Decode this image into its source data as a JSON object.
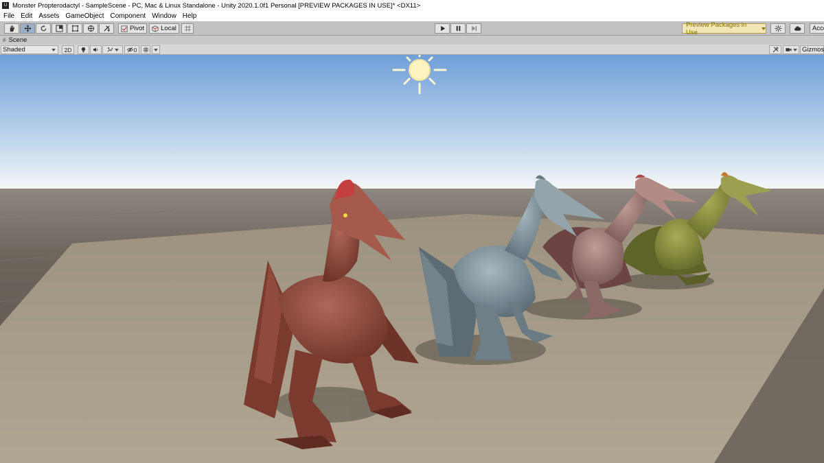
{
  "window": {
    "title": "Monster Propterodactyl - SampleScene - PC, Mac & Linux Standalone - Unity 2020.1.0f1 Personal [PREVIEW PACKAGES IN USE]* <DX11>",
    "app_icon_glyph": "U"
  },
  "menu": [
    "File",
    "Edit",
    "Assets",
    "GameObject",
    "Component",
    "Window",
    "Help"
  ],
  "toolbar": {
    "pivot_label": "Pivot",
    "local_label": "Local",
    "preview_label": "Preview Packages in Use",
    "account_label": "Acco",
    "icons": [
      "hand-icon",
      "move-icon",
      "rotate-icon",
      "scale-icon",
      "rect-icon",
      "transform-icon",
      "custom-tool-icon",
      "play-icon",
      "pause-icon",
      "step-icon",
      "collab-icon",
      "cloud-icon"
    ]
  },
  "scene_tab": {
    "label": "Scene"
  },
  "scene_toolbar": {
    "shading_mode": "Shaded",
    "mode_2d": "2D",
    "hidden_count": "0",
    "gizmos_label": "Gizmos"
  },
  "colors": {
    "sky_top": "#6f9fd8",
    "sky_horizon": "#f4f6f7",
    "ground": "#6d645c",
    "plane": "#a79d8b",
    "red_dino": "#8a4a3c",
    "blue_dino": "#7f95a0",
    "pink_dino": "#9d7a78",
    "green_dino": "#8b8f3e"
  }
}
